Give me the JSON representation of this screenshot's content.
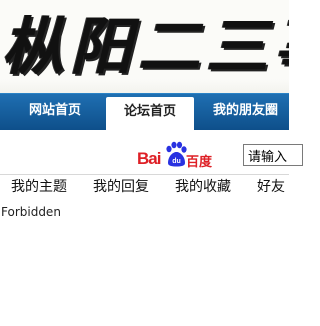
{
  "banner": {
    "title": "枞阳二三事"
  },
  "nav": {
    "tabs": [
      {
        "label": "网站首页"
      },
      {
        "label": "论坛首页"
      },
      {
        "label": "我的朋友圈"
      }
    ],
    "active_tab": "论坛首页"
  },
  "search": {
    "logo_text_latin": "Bai",
    "logo_paw_text": "du",
    "logo_text_cn": "百度",
    "input_value": "请输入"
  },
  "subnav": {
    "items": [
      {
        "label": "我的主题"
      },
      {
        "label": "我的回复"
      },
      {
        "label": "我的收藏"
      },
      {
        "label": "好友"
      }
    ]
  },
  "content": {
    "message": "Forbidden"
  },
  "colors": {
    "nav_blue": "#1565a8",
    "baidu_red": "#de2026",
    "baidu_blue": "#2932e1"
  }
}
